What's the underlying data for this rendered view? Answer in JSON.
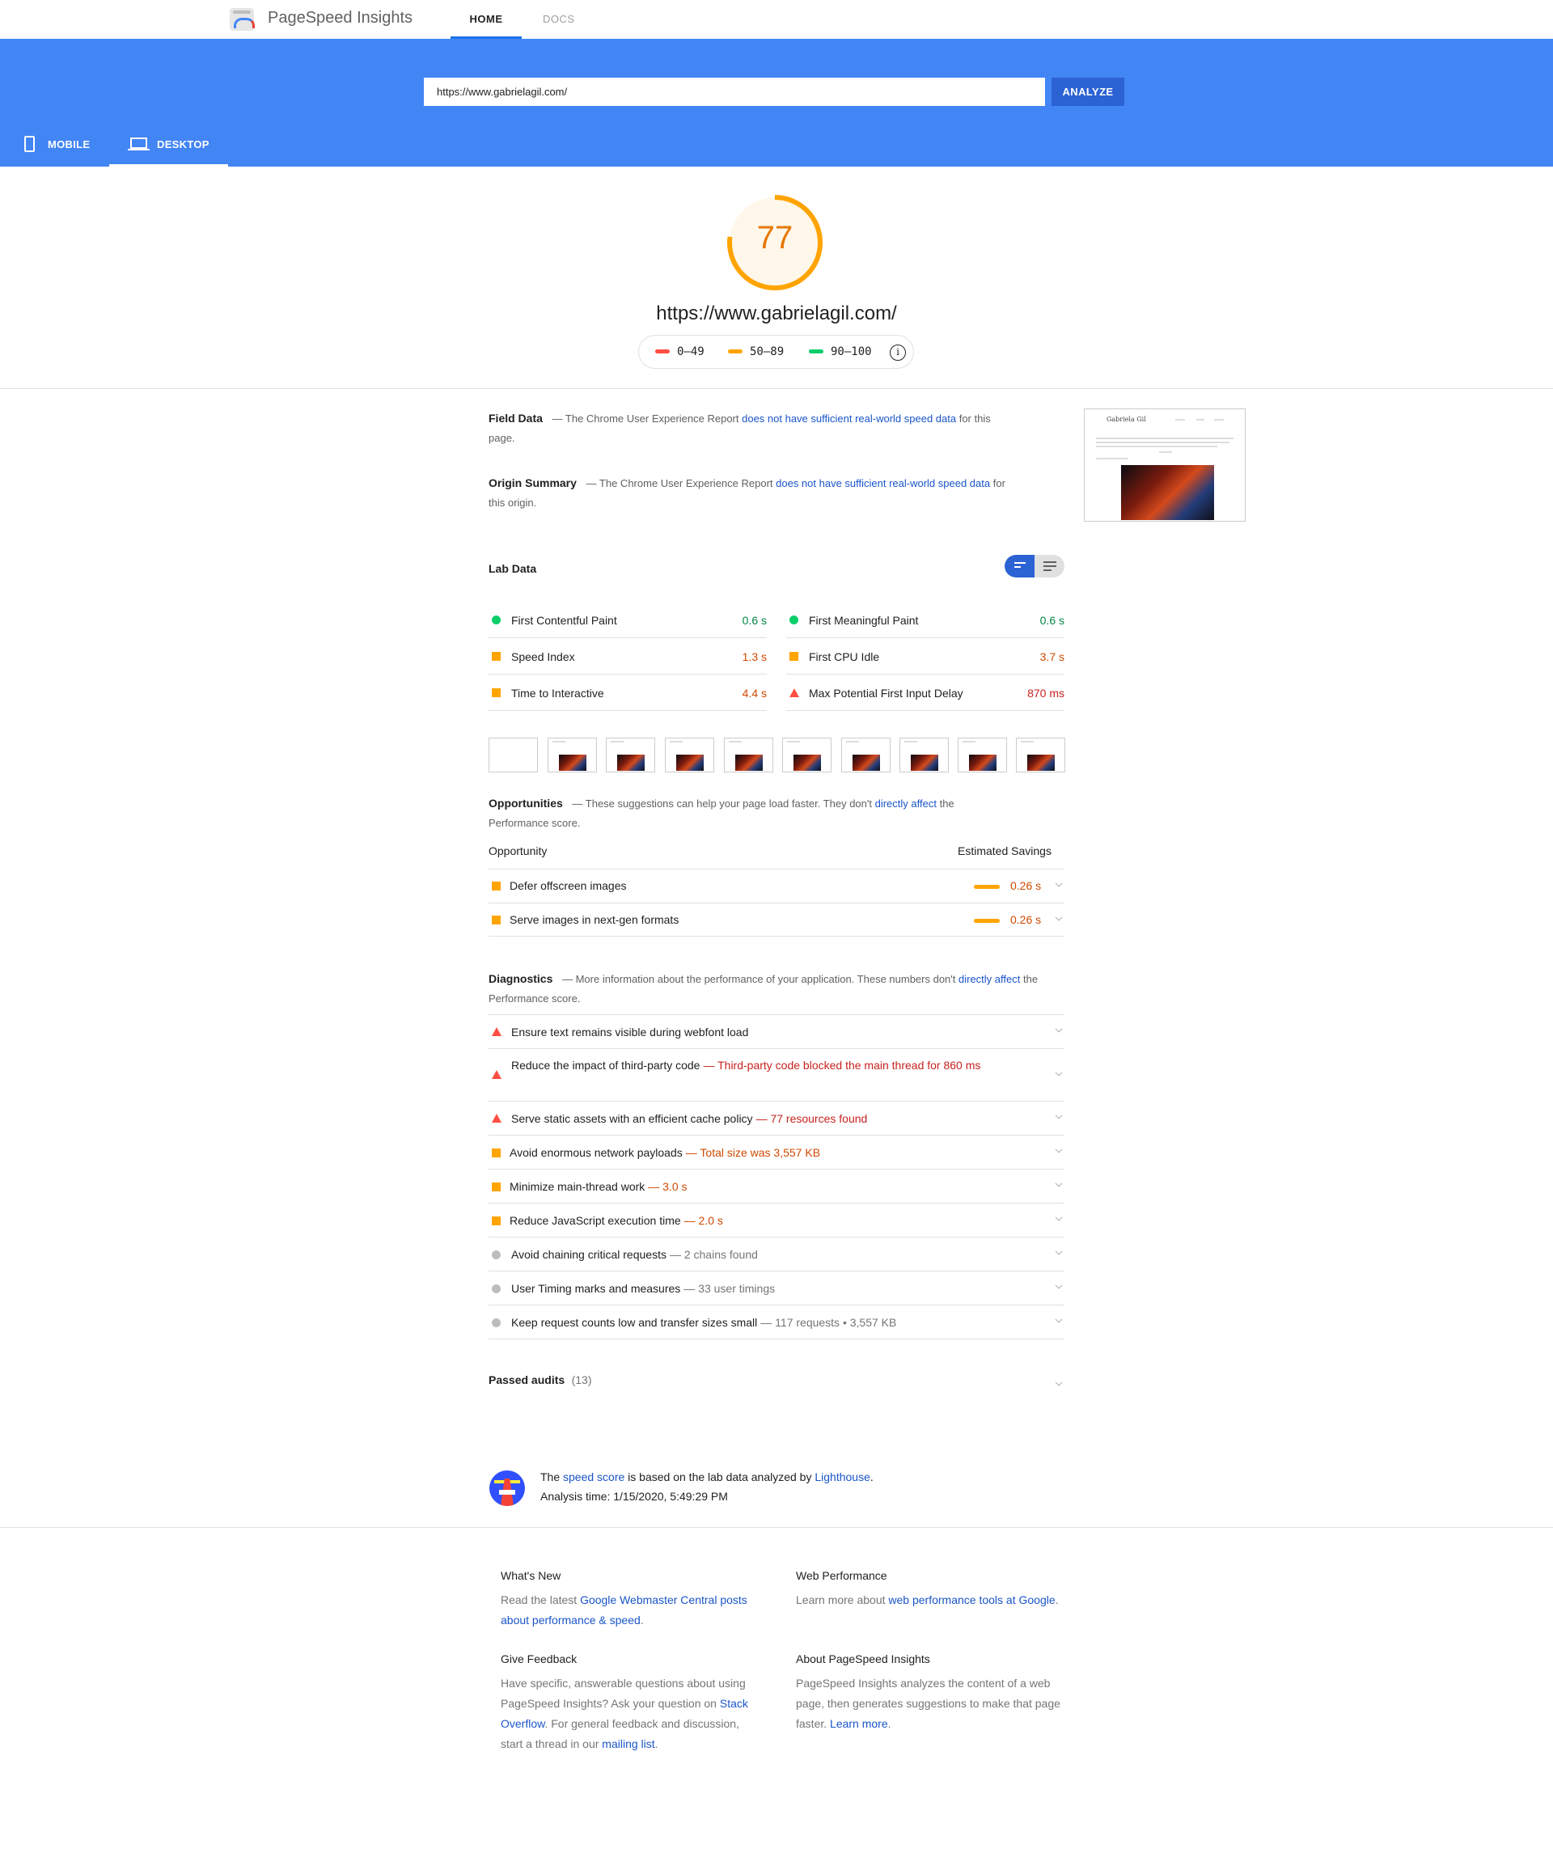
{
  "header": {
    "app_title": "PageSpeed Insights",
    "nav": {
      "home": "HOME",
      "docs": "DOCS"
    },
    "url_value": "https://www.gabrielagil.com/",
    "analyze_label": "ANALYZE",
    "device_tabs": {
      "mobile": "MOBILE",
      "desktop": "DESKTOP"
    }
  },
  "score": {
    "value": 77,
    "url": "https://www.gabrielagil.com/",
    "legend": [
      "0–49",
      "50–89",
      "90–100"
    ],
    "colors": {
      "bad": "#ff4e42",
      "average": "#ffa400",
      "good": "#0cce6b"
    }
  },
  "field_data": {
    "title": "Field Data",
    "pre": "— The Chrome User Experience Report ",
    "link": "does not have sufficient real-world speed data",
    "post": " for this page."
  },
  "origin_summary": {
    "title": "Origin Summary",
    "pre": "— The Chrome User Experience Report ",
    "link": "does not have sufficient real-world speed data",
    "post": " for this origin."
  },
  "thumbnail": {
    "site_title": "Gabriela Gil"
  },
  "lab_data": {
    "title": "Lab Data",
    "metrics": [
      {
        "name": "First Contentful Paint",
        "value": "0.6 s"
      },
      {
        "name": "First Meaningful Paint",
        "value": "0.6 s"
      },
      {
        "name": "Speed Index",
        "value": "1.3 s"
      },
      {
        "name": "First CPU Idle",
        "value": "3.7 s"
      },
      {
        "name": "Time to Interactive",
        "value": "4.4 s"
      },
      {
        "name": "Max Potential First Input Delay",
        "value": "870 ms"
      }
    ]
  },
  "opportunities": {
    "title": "Opportunities",
    "desc_pre": "— These suggestions can help your page load faster. They don't ",
    "desc_link": "directly affect",
    "desc_post": " the Performance score.",
    "col_left": "Opportunity",
    "col_right": "Estimated Savings",
    "items": [
      {
        "name": "Defer offscreen images",
        "value": "0.26 s"
      },
      {
        "name": "Serve images in next-gen formats",
        "value": "0.26 s"
      }
    ]
  },
  "diagnostics": {
    "title": "Diagnostics",
    "desc_pre": "— More information about the performance of your application. These numbers don't ",
    "desc_link": "directly affect",
    "desc_post": " the Performance score.",
    "items": [
      {
        "name": "Ensure text remains visible during webfont load",
        "detail": ""
      },
      {
        "name": "Reduce the impact of third-party code",
        "detail": "— Third-party code blocked the main thread for 860 ms"
      },
      {
        "name": "Serve static assets with an efficient cache policy",
        "detail": "— 77 resources found"
      },
      {
        "name": "Avoid enormous network payloads",
        "detail": "— Total size was 3,557 KB"
      },
      {
        "name": "Minimize main-thread work",
        "detail": "— 3.0 s"
      },
      {
        "name": "Reduce JavaScript execution time",
        "detail": "— 2.0 s"
      },
      {
        "name": "Avoid chaining critical requests",
        "detail": "— 2 chains found"
      },
      {
        "name": "User Timing marks and measures",
        "detail": "— 33 user timings"
      },
      {
        "name": "Keep request counts low and transfer sizes small",
        "detail": "— 117 requests • 3,557 KB"
      }
    ]
  },
  "passed_audits": {
    "title": "Passed audits",
    "count": "(13)"
  },
  "lighthouse": {
    "pre": "The ",
    "link1": "speed score",
    "mid": " is based on the lab data analyzed by ",
    "link2": "Lighthouse",
    "post": ".",
    "analysis_time": "Analysis time: 1/15/2020, 5:49:29 PM"
  },
  "footer": {
    "whats_new": {
      "title": "What's New",
      "pre": "Read the latest ",
      "link": "Google Webmaster Central posts about performance & speed",
      "post": "."
    },
    "web_performance": {
      "title": "Web Performance",
      "pre": "Learn more about ",
      "link": "web performance tools at Google",
      "post": "."
    },
    "give_feedback": {
      "title": "Give Feedback",
      "pre": "Have specific, answerable questions about using PageSpeed Insights? Ask your question on ",
      "link1": "Stack Overflow",
      "mid": ". For general feedback and discussion, start a thread in our ",
      "link2": "mailing list",
      "post": "."
    },
    "about": {
      "title": "About PageSpeed Insights",
      "pre": "PageSpeed Insights analyzes the content of a web page, then generates suggestions to make that page faster. ",
      "link": "Learn more",
      "post": "."
    }
  }
}
